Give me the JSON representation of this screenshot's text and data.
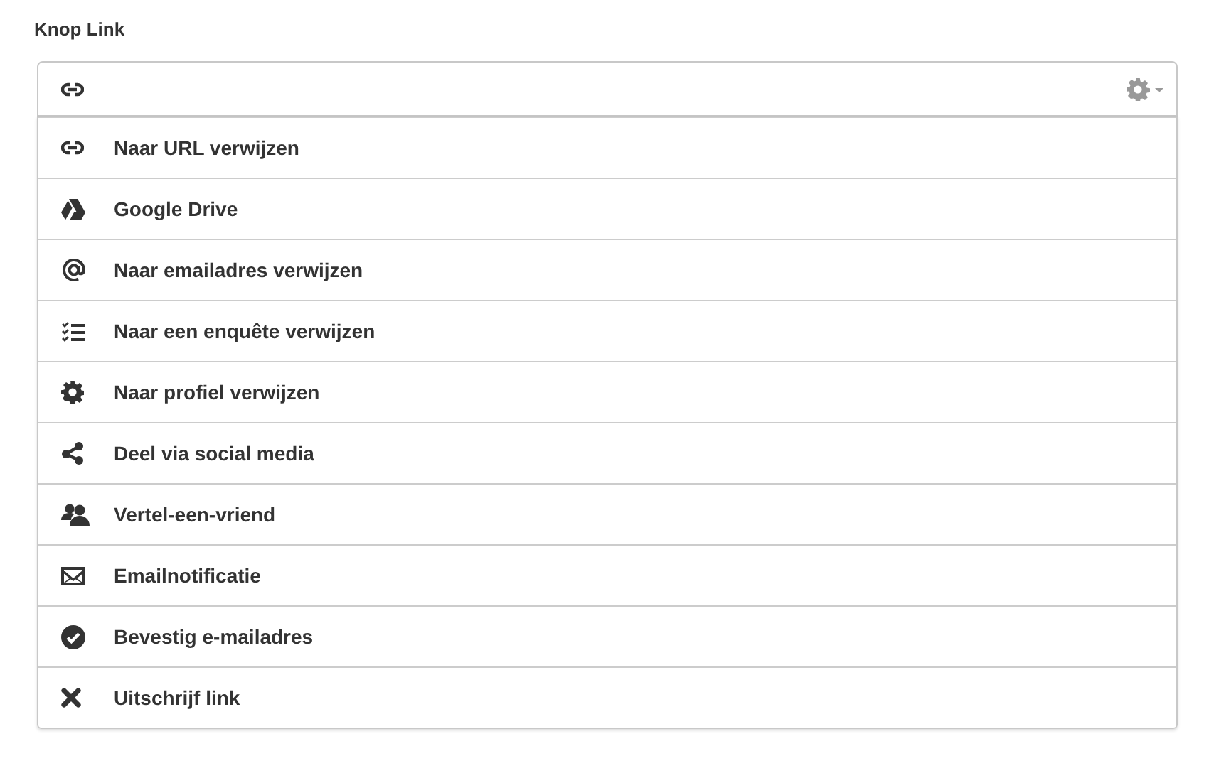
{
  "field_label": "Knop Link",
  "menu": {
    "items": [
      {
        "label": "Naar URL verwijzen"
      },
      {
        "label": "Google Drive"
      },
      {
        "label": "Naar emailadres verwijzen"
      },
      {
        "label": "Naar een enquête verwijzen"
      },
      {
        "label": "Naar profiel verwijzen"
      },
      {
        "label": "Deel via social media"
      },
      {
        "label": "Vertel-een-vriend"
      },
      {
        "label": "Emailnotificatie"
      },
      {
        "label": "Bevestig e-mailadres"
      },
      {
        "label": "Uitschrijf link"
      }
    ]
  }
}
